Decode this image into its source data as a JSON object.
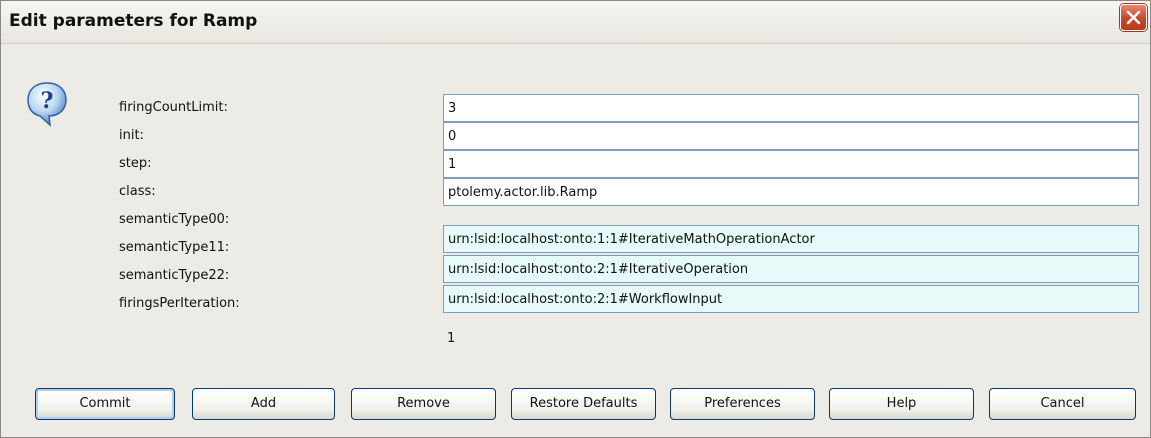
{
  "window": {
    "title": "Edit parameters for Ramp",
    "close_icon": "close-icon",
    "help_icon": "question-mark-icon"
  },
  "params": [
    {
      "label": "firingCountLimit:",
      "value": "3",
      "kind": "text"
    },
    {
      "label": "init:",
      "value": "0",
      "kind": "text"
    },
    {
      "label": "step:",
      "value": "1",
      "kind": "text"
    },
    {
      "label": "class:",
      "value": "ptolemy.actor.lib.Ramp",
      "kind": "text"
    },
    {
      "label": "semanticType00:",
      "value": "urn:lsid:localhost:onto:1:1#IterativeMathOperationActor",
      "kind": "semantic"
    },
    {
      "label": "semanticType11:",
      "value": "urn:lsid:localhost:onto:2:1#IterativeOperation",
      "kind": "semantic"
    },
    {
      "label": "semanticType22:",
      "value": "urn:lsid:localhost:onto:2:1#WorkflowInput",
      "kind": "semantic"
    },
    {
      "label": "firingsPerIteration:",
      "value": "1",
      "kind": "static"
    }
  ],
  "buttons": {
    "commit": "Commit",
    "add": "Add",
    "remove": "Remove",
    "restore_defaults": "Restore Defaults",
    "preferences": "Preferences",
    "help": "Help",
    "cancel": "Cancel"
  },
  "colors": {
    "semantic_field_bg": "#e6fafa",
    "close_button": "#c8472a",
    "button_border": "#003c74"
  }
}
